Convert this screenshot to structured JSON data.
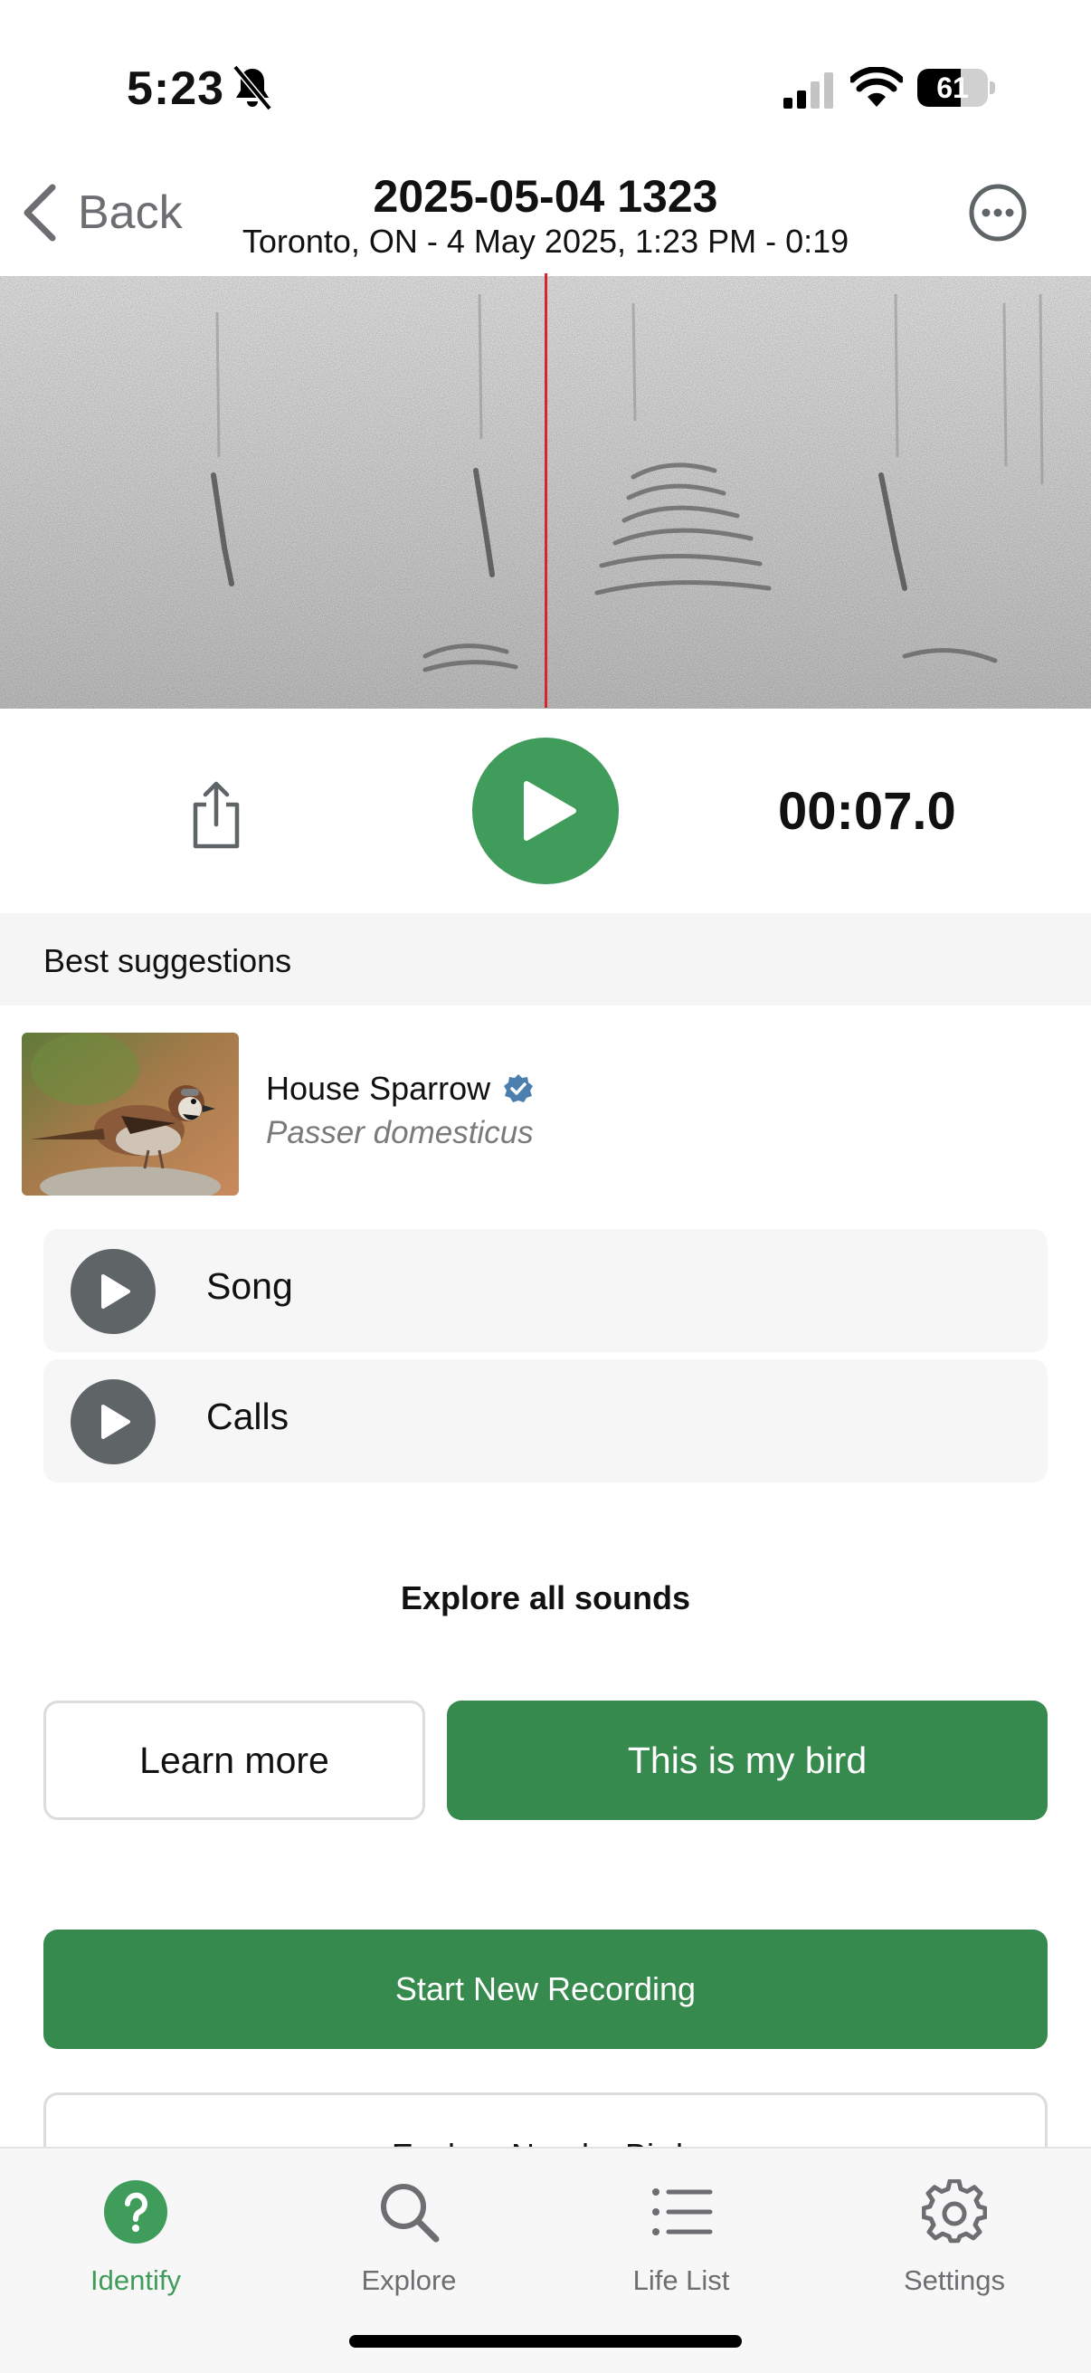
{
  "status_bar": {
    "time": "5:23",
    "battery": "61",
    "battery_level_percent": 61
  },
  "nav": {
    "back_label": "Back",
    "title": "2025-05-04 1323",
    "subtitle": "Toronto, ON - 4 May 2025, 1:23 PM - 0:19"
  },
  "player": {
    "time": "00:07.0"
  },
  "suggestions": {
    "header": "Best suggestions",
    "bird": {
      "common_name": "House Sparrow",
      "scientific_name": "Passer domesticus",
      "verified": true
    },
    "sounds": [
      {
        "label": "Song"
      },
      {
        "label": "Calls"
      }
    ],
    "explore_all": "Explore all sounds"
  },
  "actions": {
    "learn_more": "Learn more",
    "this_is_my_bird": "This is my bird",
    "start_new_recording": "Start New Recording",
    "explore_nearby": "Explore Nearby Birds"
  },
  "tabs": [
    {
      "label": "Identify",
      "active": true
    },
    {
      "label": "Explore",
      "active": false
    },
    {
      "label": "Life List",
      "active": false
    },
    {
      "label": "Settings",
      "active": false
    }
  ],
  "colors": {
    "accent_green": "#3f9c5a",
    "button_green": "#378a4d",
    "playhead_red": "#d7262b",
    "sound_play_gray": "#5f6467"
  }
}
